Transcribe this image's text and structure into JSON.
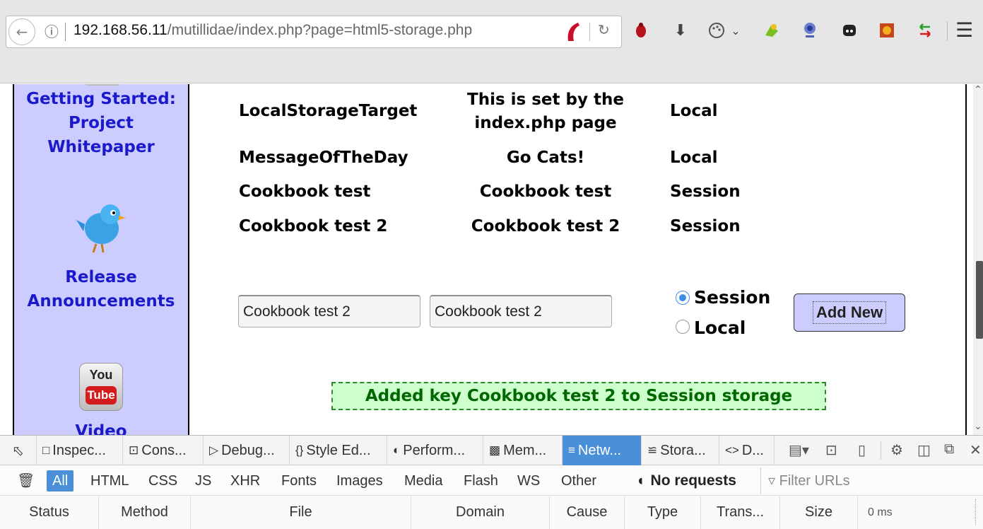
{
  "browser": {
    "url_host": "192.168.56.11",
    "url_path": "/mutillidae/index.php?page=html5-storage.php",
    "icons": [
      "back-icon",
      "info-icon",
      "reload-icon",
      "bug-icon",
      "download-icon",
      "palette-icon",
      "chevron-down-icon",
      "extension-icon",
      "webcam-icon",
      "alien-icon",
      "firebug-icon",
      "network-arrows-icon",
      "menu-icon"
    ]
  },
  "sidebar": {
    "items": [
      {
        "label": "Getting Started: Project Whitepaper"
      },
      {
        "label": "Release Announcements"
      },
      {
        "label": "Video"
      }
    ],
    "bird_icon": "twitter-bird-icon",
    "youtube_icon": {
      "top": "You",
      "bottom": "Tube"
    }
  },
  "storage_table": {
    "rows": [
      {
        "key": "LocalStorageTarget",
        "value_line1": "This is set by the",
        "value_line2": "index.php page",
        "type": "Local"
      },
      {
        "key": "MessageOfTheDay",
        "value": "Go Cats!",
        "type": "Local"
      },
      {
        "key": "Cookbook test",
        "value": "Cookbook test",
        "type": "Session"
      },
      {
        "key": "Cookbook test 2",
        "value": "Cookbook test 2",
        "type": "Session"
      }
    ]
  },
  "form": {
    "key_value": "Cookbook test 2",
    "value_value": "Cookbook test 2",
    "radio_session": "Session",
    "radio_local": "Local",
    "selected": "Session",
    "add_button": "Add New"
  },
  "status_message": "Added key Cookbook test 2 to Session storage",
  "devtools": {
    "tabs": [
      {
        "label": "Inspec...",
        "icon": "inspector-icon"
      },
      {
        "label": "Cons...",
        "icon": "console-icon"
      },
      {
        "label": "Debug...",
        "icon": "debugger-icon"
      },
      {
        "label": "Style Ed...",
        "icon": "style-editor-icon"
      },
      {
        "label": "Perform...",
        "icon": "performance-icon"
      },
      {
        "label": "Mem...",
        "icon": "memory-icon"
      },
      {
        "label": "Netw...",
        "icon": "network-icon"
      },
      {
        "label": "Stora...",
        "icon": "storage-icon"
      },
      {
        "label": "D...",
        "icon": "dom-icon"
      }
    ],
    "active_tab": "Netw...",
    "filters": [
      "All",
      "HTML",
      "CSS",
      "JS",
      "XHR",
      "Fonts",
      "Images",
      "Media",
      "Flash",
      "WS",
      "Other"
    ],
    "active_filter": "All",
    "no_requests": "No requests",
    "filter_placeholder": "Filter URLs",
    "columns": [
      "Status",
      "Method",
      "File",
      "Domain",
      "Cause",
      "Type",
      "Trans...",
      "Size"
    ],
    "timeline_label": "0 ms",
    "accent_color": "#4a90d9"
  }
}
